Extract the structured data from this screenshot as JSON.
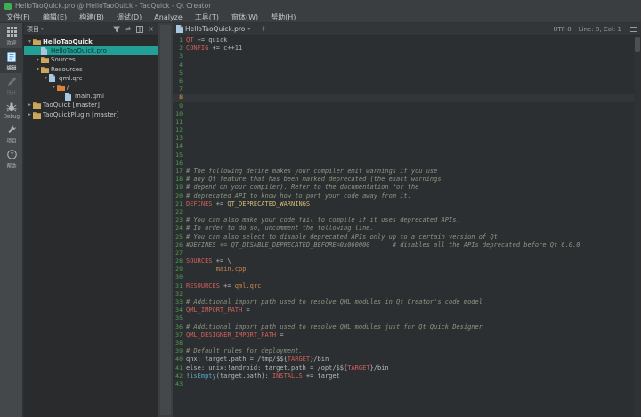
{
  "window": {
    "title": "HelloTaoQuick.pro @ HelloTaoQuick - TaoQuick - Qt Creator"
  },
  "menu_bar": {
    "items": [
      "文件(F)",
      "编辑(E)",
      "构建(B)",
      "调试(D)",
      "Analyze",
      "工具(T)",
      "窗体(W)",
      "帮助(H)"
    ]
  },
  "mode_rail": {
    "items": [
      {
        "label": "欢迎",
        "icon": "welcome-grid-icon",
        "selected": false,
        "enabled": true
      },
      {
        "label": "编辑",
        "icon": "edit-document-icon",
        "selected": true,
        "enabled": true
      },
      {
        "label": "设计",
        "icon": "design-pencil-icon",
        "selected": false,
        "enabled": false
      },
      {
        "label": "Debug",
        "icon": "debug-bug-icon",
        "selected": false,
        "enabled": true
      },
      {
        "label": "项目",
        "icon": "projects-wrench-icon",
        "selected": false,
        "enabled": true
      },
      {
        "label": "帮助",
        "icon": "help-icon",
        "selected": false,
        "enabled": true
      }
    ]
  },
  "project_panel": {
    "title": "项目",
    "header_icons": [
      "filter-icon",
      "sync-icon",
      "split-icon",
      "close-icon"
    ],
    "tree": [
      {
        "label": "HelloTaoQuick",
        "level": 0,
        "chevron": "open",
        "icon": "folder",
        "root": true,
        "selected": false
      },
      {
        "label": "HelloTaoQuick.pro",
        "level": 1,
        "chevron": "none",
        "icon": "file",
        "root": false,
        "selected": true
      },
      {
        "label": "Sources",
        "level": 1,
        "chevron": "closed",
        "icon": "folder",
        "root": false,
        "selected": false
      },
      {
        "label": "Resources",
        "level": 1,
        "chevron": "open",
        "icon": "folder",
        "root": false,
        "selected": false
      },
      {
        "label": "qml.qrc",
        "level": 2,
        "chevron": "open",
        "icon": "file",
        "root": false,
        "selected": false
      },
      {
        "label": "/",
        "level": 3,
        "chevron": "open",
        "icon": "folder-orange",
        "root": false,
        "selected": false
      },
      {
        "label": "main.qml",
        "level": 4,
        "chevron": "none",
        "icon": "file",
        "root": false,
        "selected": false
      },
      {
        "label": "TaoQuick [master]",
        "level": 0,
        "chevron": "closed",
        "icon": "folder",
        "root": false,
        "selected": false
      },
      {
        "label": "TaoQuickPlugin [master]",
        "level": 0,
        "chevron": "closed",
        "icon": "folder",
        "root": false,
        "selected": false
      }
    ]
  },
  "editor": {
    "toolbar": {
      "file_name": "HelloTaoQuick.pro",
      "encoding": "UTF-8",
      "cursor": "Line: 8, Col: 1"
    },
    "current_line": 8,
    "lines": [
      [
        {
          "t": "QT",
          "c": "k"
        },
        {
          "t": " += ",
          "c": "p"
        },
        {
          "t": "quick",
          "c": "p"
        }
      ],
      [
        {
          "t": "CONFIG",
          "c": "k"
        },
        {
          "t": " += ",
          "c": "p"
        },
        {
          "t": "c++11",
          "c": "p"
        }
      ],
      [],
      [],
      [],
      [],
      [],
      [],
      [],
      [],
      [],
      [],
      [],
      [],
      [],
      [],
      [
        {
          "t": "# The following define makes your compiler emit warnings if you use",
          "c": "c"
        }
      ],
      [
        {
          "t": "# any Qt feature that has been marked deprecated (the exact warnings",
          "c": "c"
        }
      ],
      [
        {
          "t": "# depend on your compiler). Refer to the documentation for the",
          "c": "c"
        }
      ],
      [
        {
          "t": "# deprecated API to know how to port your code away from it.",
          "c": "c"
        }
      ],
      [
        {
          "t": "DEFINES",
          "c": "k"
        },
        {
          "t": " += ",
          "c": "p"
        },
        {
          "t": "QT_DEPRECATED_WARNINGS",
          "c": "m"
        }
      ],
      [],
      [
        {
          "t": "# You can also make your code fail to compile if it uses deprecated APIs.",
          "c": "c"
        }
      ],
      [
        {
          "t": "# In order to do so, uncomment the following line.",
          "c": "c"
        }
      ],
      [
        {
          "t": "# You can also select to disable deprecated APIs only up to a certain version of Qt.",
          "c": "c"
        }
      ],
      [
        {
          "t": "#DEFINES += QT_DISABLE_DEPRECATED_BEFORE=0x060000      # disables all the APIs deprecated before Qt 6.0.0",
          "c": "c"
        }
      ],
      [],
      [
        {
          "t": "SOURCES",
          "c": "k"
        },
        {
          "t": " += \\",
          "c": "p"
        }
      ],
      [
        {
          "t": "        ",
          "c": "p"
        },
        {
          "t": "main.cpp",
          "c": "s"
        }
      ],
      [],
      [
        {
          "t": "RESOURCES",
          "c": "k"
        },
        {
          "t": " += ",
          "c": "p"
        },
        {
          "t": "qml.qrc",
          "c": "s"
        }
      ],
      [],
      [
        {
          "t": "# Additional import path used to resolve QML modules in Qt Creator's code model",
          "c": "c"
        }
      ],
      [
        {
          "t": "QML_IMPORT_PATH",
          "c": "k"
        },
        {
          "t": " =",
          "c": "p"
        }
      ],
      [],
      [
        {
          "t": "# Additional import path used to resolve QML modules just for Qt Quick Designer",
          "c": "c"
        }
      ],
      [
        {
          "t": "QML_DESIGNER_IMPORT_PATH",
          "c": "k"
        },
        {
          "t": " =",
          "c": "p"
        }
      ],
      [],
      [
        {
          "t": "# Default rules for deployment.",
          "c": "c"
        }
      ],
      [
        {
          "t": "qnx: target.path = /tmp/$${",
          "c": "p"
        },
        {
          "t": "TARGET",
          "c": "k"
        },
        {
          "t": "}/bin",
          "c": "p"
        }
      ],
      [
        {
          "t": "else: unix:!android: target.path = /opt/$${",
          "c": "p"
        },
        {
          "t": "TARGET",
          "c": "k"
        },
        {
          "t": "}/bin",
          "c": "p"
        }
      ],
      [
        {
          "t": "!",
          "c": "p"
        },
        {
          "t": "isEmpty",
          "c": "f"
        },
        {
          "t": "(target.path): ",
          "c": "p"
        },
        {
          "t": "INSTALLS",
          "c": "k"
        },
        {
          "t": " += target",
          "c": "p"
        }
      ],
      []
    ]
  },
  "colors": {
    "accent_selection": "#23a096",
    "gutter_green": "#55a055",
    "current_line_number": "#e5a33c",
    "keyword_red": "#d0605a",
    "macro_yellow": "#d3bd74",
    "string_tan": "#c98950",
    "comment_green": "#8d9682",
    "function_cyan": "#57a8c7"
  }
}
